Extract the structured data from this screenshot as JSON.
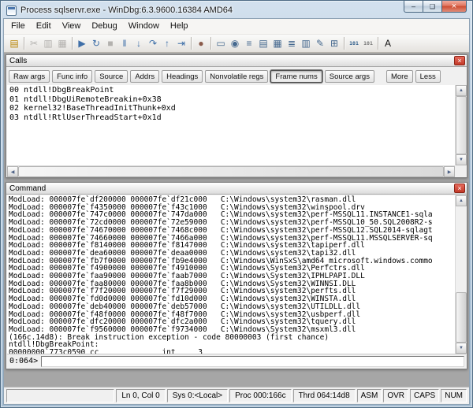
{
  "window": {
    "title": "Process sqlservr.exe - WinDbg:6.3.9600.16384 AMD64",
    "controls": {
      "minimize": "–",
      "maximize": "❑",
      "close": "×"
    },
    "menus": [
      "File",
      "Edit",
      "View",
      "Debug",
      "Window",
      "Help"
    ]
  },
  "toolbar": {
    "items": [
      {
        "name": "open-source-file-icon",
        "glyph": "▤",
        "color": "#b8860b",
        "enabled": true
      },
      {
        "type": "sep",
        "name": "toolbar-separator",
        "interactable": false
      },
      {
        "name": "cut-icon",
        "glyph": "✂",
        "enabled": false
      },
      {
        "name": "copy-icon",
        "glyph": "▥",
        "enabled": false
      },
      {
        "name": "paste-icon",
        "glyph": "▦",
        "enabled": false
      },
      {
        "type": "sep",
        "name": "toolbar-separator",
        "interactable": false
      },
      {
        "name": "go-icon",
        "glyph": "▶",
        "color": "#3f6fa8",
        "enabled": true
      },
      {
        "name": "restart-icon",
        "glyph": "↻",
        "color": "#3f6fa8",
        "enabled": true
      },
      {
        "name": "stop-debugging-icon",
        "glyph": "■",
        "enabled": false
      },
      {
        "name": "break-icon",
        "glyph": "‖",
        "color": "#3f6fa8",
        "enabled": true
      },
      {
        "name": "step-into-icon",
        "glyph": "↓",
        "color": "#3f6fa8",
        "enabled": true
      },
      {
        "name": "step-over-icon",
        "glyph": "↷",
        "color": "#3f6fa8",
        "enabled": true
      },
      {
        "name": "step-out-icon",
        "glyph": "↑",
        "color": "#3f6fa8",
        "enabled": true
      },
      {
        "name": "run-to-cursor-icon",
        "glyph": "⇥",
        "color": "#3f6fa8",
        "enabled": true
      },
      {
        "type": "sep",
        "name": "toolbar-separator",
        "interactable": false
      },
      {
        "name": "insert-breakpoint-icon",
        "glyph": "●",
        "color": "#8a5a4a",
        "enabled": true
      },
      {
        "type": "sep",
        "name": "toolbar-separator",
        "interactable": false
      },
      {
        "name": "command-window-icon",
        "glyph": "▭",
        "color": "#46698f",
        "enabled": true
      },
      {
        "name": "watch-window-icon",
        "glyph": "◉",
        "color": "#46698f",
        "enabled": true
      },
      {
        "name": "locals-window-icon",
        "glyph": "≡",
        "color": "#46698f",
        "enabled": true
      },
      {
        "name": "registers-window-icon",
        "glyph": "▤",
        "color": "#46698f",
        "enabled": true
      },
      {
        "name": "memory-window-icon",
        "glyph": "▦",
        "color": "#46698f",
        "enabled": true
      },
      {
        "name": "call-stack-window-icon",
        "glyph": "≣",
        "color": "#46698f",
        "enabled": true
      },
      {
        "name": "disassembly-window-icon",
        "glyph": "▥",
        "color": "#46698f",
        "enabled": true
      },
      {
        "name": "scratch-pad-window-icon",
        "glyph": "✎",
        "color": "#46698f",
        "enabled": true
      },
      {
        "name": "processes-window-icon",
        "glyph": "⊞",
        "color": "#46698f",
        "enabled": true
      },
      {
        "type": "sep",
        "name": "toolbar-separator",
        "interactable": false
      },
      {
        "name": "source-mode-on-icon",
        "glyph": "101",
        "small": true,
        "color": "#2f5d8a",
        "enabled": true
      },
      {
        "name": "source-mode-off-icon",
        "glyph": "101",
        "small": true,
        "color": "#777777",
        "enabled": true
      },
      {
        "type": "sep",
        "name": "toolbar-separator",
        "interactable": false
      },
      {
        "name": "font-icon",
        "glyph": "A",
        "color": "#111111",
        "enabled": true
      }
    ]
  },
  "calls": {
    "title": "Calls",
    "close_glyph": "×",
    "buttons": [
      {
        "name": "raw-args-button",
        "label": "Raw args"
      },
      {
        "name": "func-info-button",
        "label": "Func info"
      },
      {
        "name": "source-button",
        "label": "Source"
      },
      {
        "name": "addrs-button",
        "label": "Addrs"
      },
      {
        "name": "headings-button",
        "label": "Headings"
      },
      {
        "name": "nonvolatile-regs-button",
        "label": "Nonvolatile regs"
      },
      {
        "name": "frame-nums-button",
        "label": "Frame nums",
        "active": true
      },
      {
        "name": "source-args-button",
        "label": "Source args"
      },
      {
        "name": "more-button",
        "label": "More",
        "gap": true
      },
      {
        "name": "less-button",
        "label": "Less"
      }
    ],
    "frames": [
      "00 ntdll!DbgBreakPoint",
      "01 ntdll!DbgUiRemoteBreakin+0x38",
      "02 kernel32!BaseThreadInitThunk+0xd",
      "03 ntdll!RtlUserThreadStart+0x1d"
    ]
  },
  "command": {
    "title": "Command",
    "close_glyph": "×",
    "output": [
      "ModLoad: 000007fe`df200000 000007fe`df21c000   C:\\Windows\\system32\\rasman.dll",
      "ModLoad: 000007fe`f4350000 000007fe`f43c1000   C:\\Windows\\system32\\winspool.drv",
      "ModLoad: 000007fe`747c0000 000007fe`747da000   C:\\Windows\\system32\\perf-MSSQL11.INSTANCE1-sqla",
      "ModLoad: 000007fe`72cd0000 000007fe`72e59000   C:\\Windows\\system32\\perf-MSSQL10_50.SQL2008R2-s",
      "ModLoad: 000007fe`74670000 000007fe`7468c000   C:\\Windows\\system32\\perf-MSSQL12.SQL2014-sqlagt",
      "ModLoad: 000007fe`74660000 000007fe`7466a000   C:\\Windows\\system32\\perf-MSSQL11.MSSQLSERVER-sq",
      "ModLoad: 000007fe`f8140000 000007fe`f8147000   C:\\Windows\\system32\\tapiperf.dll",
      "ModLoad: 000007fe`dea60000 000007fe`deaa0000   C:\\Windows\\system32\\tapi32.dll",
      "ModLoad: 000007fe`fb7f0000 000007fe`fb9e4000   C:\\Windows\\WinSxS\\amd64_microsoft.windows.commo",
      "ModLoad: 000007fe`f4900000 000007fe`f4910000   C:\\Windows\\System32\\Perfctrs.dll",
      "ModLoad: 000007fe`faa90000 000007fe`faab7000   C:\\Windows\\System32\\IPHLPAPI.DLL",
      "ModLoad: 000007fe`faa80000 000007fe`faa8b000   C:\\Windows\\System32\\WINNSI.DLL",
      "ModLoad: 000007fe`f7f20000 000007fe`f7f29000   C:\\Windows\\system32\\perfts.dll",
      "ModLoad: 000007fe`fd0d0000 000007fe`fd10d000   C:\\Windows\\system32\\WINSTA.dll",
      "ModLoad: 000007fe`deb40000 000007fe`deb57000   C:\\Windows\\system32\\UTILDLL.dll",
      "ModLoad: 000007fe`f48f0000 000007fe`f48f7000   C:\\Windows\\system32\\usbperf.dll",
      "ModLoad: 000007fe`dfc20000 000007fe`dfc2a000   C:\\Windows\\system32\\tquery.dll",
      "ModLoad: 000007fe`f9560000 000007fe`f9734000   C:\\Windows\\System32\\msxml3.dll",
      "(166c.14d8): Break instruction exception - code 80000003 (first chance)",
      "ntdll!DbgBreakPoint:",
      "00000000`773c0590 cc              int     3"
    ],
    "prompt": "0:064>"
  },
  "scrollbar": {
    "up": "▲",
    "down": "▼",
    "left": "◀",
    "right": "▶"
  },
  "statusbar": {
    "message": "",
    "line_col": "Ln 0, Col 0",
    "sys": "Sys 0:<Local>",
    "proc": "Proc 000:166c",
    "thrd": "Thrd 064:14d8",
    "indicators": [
      "ASM",
      "OVR",
      "CAPS",
      "NUM"
    ]
  },
  "colors": {
    "frame_aero": "#b9cde0",
    "close_button_red": "#cd4b31",
    "panel_close_red": "#c23a29",
    "workspace_grey": "#a6a6a6"
  }
}
